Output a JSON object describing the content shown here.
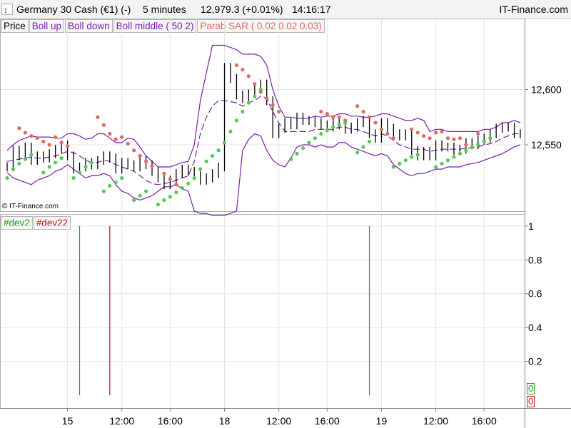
{
  "header": {
    "instrument": "Germany 30 Cash (€1) (-)",
    "timeframe": "5 minutes",
    "quote": "12,979.3 (+0.01%)",
    "time": "14:16:17",
    "brand": "IT-Finance.com"
  },
  "legend_top": [
    {
      "label": "Price",
      "color": "#000000"
    },
    {
      "label": "Boll up",
      "color": "#7a1fa8"
    },
    {
      "label": "Boll down",
      "color": "#7a1fa8"
    },
    {
      "label": "Boll middle ( 50 2)",
      "color": "#7a1fa8"
    },
    {
      "label": "Parab SAR ( 0.02 0.02 0.03)",
      "color": "#e06a5e"
    }
  ],
  "legend_bottom": [
    {
      "label": "#dev2",
      "color": "#1aa01a"
    },
    {
      "label": "#dev22",
      "color": "#cc1111"
    }
  ],
  "copyright": "© IT-Finance.com",
  "colors": {
    "price": "#000000",
    "bollinger": "#7a1fa8",
    "sar_above": "#e06a5e",
    "sar_below": "#55c855",
    "dev2": "#1aa01a",
    "dev22": "#cc1111",
    "grid": "#e4e4e4"
  },
  "chart_data": [
    {
      "type": "line",
      "ylim": [
        12490,
        12650
      ],
      "yticks": [
        "12,600",
        "12,550"
      ],
      "ytick_values": [
        12600,
        12550
      ],
      "xticks": [
        "15",
        "12:00",
        "16:00",
        "18",
        "12:00",
        "16:00",
        "19",
        "12:00",
        "16:00"
      ],
      "xtick_positions": [
        10,
        19,
        27,
        36,
        45,
        53,
        62,
        71,
        79
      ],
      "x_count": 86,
      "series": [
        {
          "name": "Price",
          "values": [
            12530,
            12545,
            12540,
            12548,
            12536,
            12540,
            12538,
            12542,
            12546,
            12550,
            12540,
            12528,
            12530,
            12534,
            12532,
            12536,
            12540,
            12538,
            12528,
            12534,
            12532,
            12530,
            12536,
            12532,
            12526,
            12520,
            12514,
            12518,
            12524,
            12528,
            12526,
            12522,
            12518,
            12520,
            12524,
            12530,
            12620,
            12610,
            12595,
            12592,
            12596,
            12600,
            12605,
            12590,
            12560,
            12565,
            12570,
            12568,
            12575,
            12572,
            12572,
            12570,
            12568,
            12566,
            12570,
            12568,
            12564,
            12566,
            12570,
            12572,
            12560,
            12556,
            12570,
            12565,
            12560,
            12558,
            12560,
            12545,
            12540,
            12544,
            12540,
            12550,
            12548,
            12548,
            12545,
            12546,
            12552,
            12550,
            12554,
            12556,
            12560,
            12565,
            12566,
            12566,
            12560,
            12560
          ]
        },
        {
          "name": "Boll up",
          "values": [
            12545,
            12550,
            12554,
            12556,
            12558,
            12557,
            12557,
            12557,
            12556,
            12556,
            12560,
            12560,
            12558,
            12555,
            12556,
            12560,
            12560,
            12556,
            12552,
            12552,
            12556,
            12555,
            12548,
            12540,
            12535,
            12530,
            12530,
            12530,
            12532,
            12534,
            12535,
            12550,
            12590,
            12615,
            12640,
            12640,
            12640,
            12638,
            12636,
            12632,
            12632,
            12632,
            12630,
            12622,
            12600,
            12585,
            12575,
            12575,
            12574,
            12574,
            12574,
            12576,
            12575,
            12576,
            12576,
            12578,
            12578,
            12576,
            12576,
            12575,
            12575,
            12576,
            12578,
            12578,
            12576,
            12574,
            12572,
            12572,
            12574,
            12572,
            12562,
            12564,
            12564,
            12562,
            12562,
            12562,
            12562,
            12562,
            12562,
            12564,
            12564,
            12566,
            12570,
            12570,
            12572,
            12570
          ]
        },
        {
          "name": "Boll down",
          "values": [
            12525,
            12520,
            12518,
            12516,
            12514,
            12518,
            12520,
            12522,
            12526,
            12528,
            12532,
            12528,
            12524,
            12520,
            12522,
            12522,
            12524,
            12522,
            12514,
            12508,
            12506,
            12502,
            12500,
            12502,
            12504,
            12508,
            12512,
            12512,
            12514,
            12510,
            12508,
            12490,
            12488,
            12488,
            12486,
            12486,
            12486,
            12488,
            12490,
            12545,
            12555,
            12560,
            12558,
            12545,
            12536,
            12532,
            12530,
            12538,
            12548,
            12550,
            12550,
            12548,
            12550,
            12548,
            12548,
            12552,
            12552,
            12548,
            12546,
            12544,
            12542,
            12540,
            12542,
            12540,
            12532,
            12528,
            12524,
            12522,
            12524,
            12524,
            12526,
            12528,
            12528,
            12530,
            12530,
            12530,
            12532,
            12533,
            12534,
            12536,
            12538,
            12540,
            12542,
            12545,
            12548,
            12550
          ]
        },
        {
          "name": "Boll middle ( 50 2)",
          "values": [
            12535,
            12536,
            12537,
            12538,
            12539,
            12538,
            12538,
            12539,
            12540,
            12542,
            12544,
            12543,
            12540,
            12536,
            12534,
            12534,
            12536,
            12535,
            12532,
            12530,
            12528,
            12526,
            12522,
            12518,
            12515,
            12514,
            12515,
            12516,
            12518,
            12520,
            12522,
            12535,
            12560,
            12575,
            12585,
            12590,
            12590,
            12589,
            12588,
            12585,
            12588,
            12590,
            12594,
            12592,
            12580,
            12570,
            12562,
            12562,
            12562,
            12562,
            12562,
            12564,
            12564,
            12564,
            12564,
            12566,
            12566,
            12564,
            12564,
            12562,
            12560,
            12558,
            12560,
            12558,
            12554,
            12550,
            12548,
            12546,
            12546,
            12546,
            12544,
            12545,
            12546,
            12546,
            12546,
            12546,
            12547,
            12547,
            12548,
            12550,
            12551,
            12553,
            12556,
            12558,
            12560,
            12560
          ]
        }
      ],
      "sar_above": [
        [
          0,
          null
        ],
        [
          1,
          null
        ],
        [
          2,
          12565
        ],
        [
          3,
          12561
        ],
        [
          4,
          12558
        ],
        [
          5,
          12556
        ],
        [
          6,
          12553
        ],
        [
          7,
          12550
        ],
        [
          8,
          12557
        ],
        [
          9,
          12552
        ],
        [
          10,
          12549
        ],
        [
          15,
          12575
        ],
        [
          16,
          12568
        ],
        [
          17,
          12560
        ],
        [
          18,
          12555
        ],
        [
          19,
          12557
        ],
        [
          20,
          12551
        ],
        [
          21,
          12545
        ],
        [
          22,
          12540
        ],
        [
          23,
          12535
        ],
        [
          24,
          12531
        ],
        [
          26,
          12524
        ],
        [
          27,
          12519
        ],
        [
          28,
          12514
        ],
        [
          38,
          12622
        ],
        [
          39,
          12618
        ],
        [
          40,
          12612
        ],
        [
          41,
          12605
        ],
        [
          42,
          12598
        ],
        [
          43,
          12592
        ],
        [
          44,
          12586
        ],
        [
          45,
          12580
        ],
        [
          52,
          12580
        ],
        [
          53,
          12578
        ],
        [
          54,
          12575
        ],
        [
          55,
          12575
        ],
        [
          56,
          12572
        ],
        [
          58,
          12585
        ],
        [
          59,
          12580
        ],
        [
          60,
          12575
        ],
        [
          61,
          12570
        ],
        [
          62,
          12564
        ],
        [
          63,
          12560
        ],
        [
          64,
          12556
        ],
        [
          67,
          12564
        ],
        [
          68,
          12561
        ],
        [
          69,
          12558
        ],
        [
          70,
          12556
        ],
        [
          71,
          12561
        ],
        [
          72,
          12562
        ],
        [
          73,
          12556
        ],
        [
          74,
          12555
        ],
        [
          75,
          12556
        ],
        [
          76,
          12550
        ],
        [
          78,
          12560
        ]
      ],
      "sar_below": [
        [
          0,
          12520
        ],
        [
          1,
          12528
        ],
        [
          2,
          12533
        ],
        [
          3,
          12537
        ],
        [
          4,
          12541
        ],
        [
          6,
          12525
        ],
        [
          7,
          12530
        ],
        [
          8,
          12534
        ],
        [
          9,
          12538
        ],
        [
          11,
          12520
        ],
        [
          12,
          12525
        ],
        [
          13,
          12530
        ],
        [
          14,
          12534
        ],
        [
          16,
          12508
        ],
        [
          17,
          12513
        ],
        [
          18,
          12516
        ],
        [
          19,
          12520
        ],
        [
          21,
          12500
        ],
        [
          22,
          12504
        ],
        [
          23,
          12508
        ],
        [
          25,
          12496
        ],
        [
          26,
          12500
        ],
        [
          27,
          12503
        ],
        [
          28,
          12507
        ],
        [
          29,
          12511
        ],
        [
          30,
          12515
        ],
        [
          31,
          12520
        ],
        [
          32,
          12528
        ],
        [
          33,
          12535
        ],
        [
          34,
          12540
        ],
        [
          35,
          12545
        ],
        [
          36,
          12552
        ],
        [
          37,
          12562
        ],
        [
          38,
          12572
        ],
        [
          39,
          12580
        ],
        [
          40,
          12588
        ],
        [
          41,
          12594
        ],
        [
          42,
          12600
        ],
        [
          47,
          12537
        ],
        [
          48,
          12542
        ],
        [
          49,
          12547
        ],
        [
          50,
          12552
        ],
        [
          51,
          12556
        ],
        [
          52,
          12560
        ],
        [
          53,
          12563
        ],
        [
          54,
          12566
        ],
        [
          55,
          12568
        ],
        [
          56,
          12570
        ],
        [
          58,
          12543
        ],
        [
          59,
          12548
        ],
        [
          60,
          12553
        ],
        [
          64,
          12530
        ],
        [
          65,
          12533
        ],
        [
          66,
          12536
        ],
        [
          67,
          12539
        ],
        [
          68,
          12541
        ],
        [
          71,
          12530
        ],
        [
          72,
          12533
        ],
        [
          73,
          12536
        ],
        [
          74,
          12539
        ],
        [
          75,
          12542
        ],
        [
          76,
          12545
        ],
        [
          77,
          12548
        ],
        [
          78,
          12550
        ],
        [
          79,
          12553
        ],
        [
          80,
          12556
        ]
      ]
    },
    {
      "type": "bar",
      "ylim": [
        0,
        1.05
      ],
      "yticks": [
        "1",
        "0.8",
        "0.6",
        "0.4",
        "0.2"
      ],
      "ytick_values": [
        1,
        0.8,
        0.6,
        0.4,
        0.2
      ],
      "series": [
        {
          "name": "#dev2",
          "events": [
            12,
            60
          ],
          "last_value": "0"
        },
        {
          "name": "#dev22",
          "events": [
            17
          ],
          "last_value": "0"
        }
      ]
    }
  ]
}
